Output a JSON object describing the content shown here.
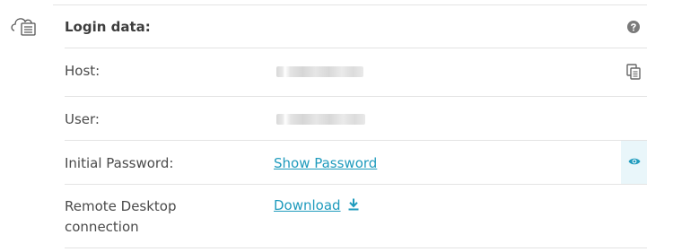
{
  "section": {
    "icon": "cloud-server-icon",
    "title": "Login data:",
    "help_icon": "question-circle-icon"
  },
  "rows": {
    "host": {
      "label": "Host:",
      "value_state": "redacted",
      "action_icon": "copy-icon"
    },
    "user": {
      "label": "User:",
      "value_state": "redacted"
    },
    "initial_password": {
      "label": "Initial Password:",
      "link": "Show Password",
      "action_icon": "eye-icon"
    },
    "remote_desktop": {
      "label": "Remote Desktop connection",
      "link": "Download",
      "link_icon": "download-icon"
    }
  },
  "colors": {
    "link": "#1f9bbd",
    "label_text": "#4a4a4a",
    "divider": "#e3e3e3",
    "highlight_cell": "#e9f6fa",
    "icon_gray": "#7a7a7a"
  }
}
